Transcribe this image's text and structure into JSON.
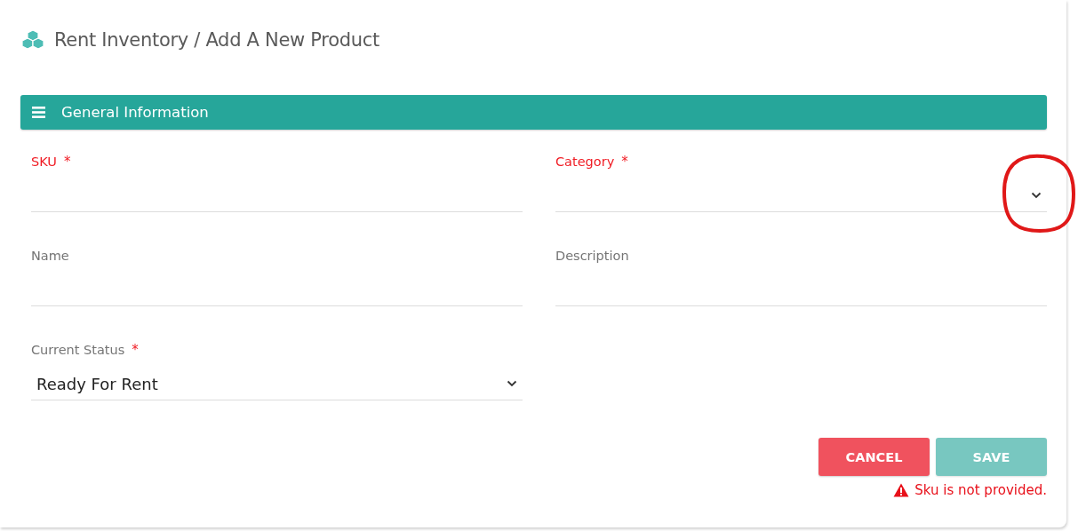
{
  "page": {
    "title": "Rent Inventory / Add A New Product"
  },
  "section": {
    "title": "General Information"
  },
  "fields": [
    {
      "kind": "text",
      "label": "SKU",
      "required_mark": "*",
      "invalid": true
    },
    {
      "kind": "select",
      "label": "Category",
      "required_mark": "*",
      "invalid": true,
      "annotated": true
    },
    {
      "kind": "text",
      "label": "Name",
      "invalid": false
    },
    {
      "kind": "text",
      "label": "Description",
      "invalid": false
    },
    {
      "kind": "select",
      "label": "Current Status",
      "required_mark": "*",
      "invalid": false,
      "value": "Ready For Rent"
    }
  ],
  "buttons": [
    {
      "kind": "cancel",
      "label": "CANCEL",
      "disabled": false
    },
    {
      "kind": "save",
      "label": "SAVE",
      "disabled": true
    }
  ],
  "error": "Sku is not provided."
}
